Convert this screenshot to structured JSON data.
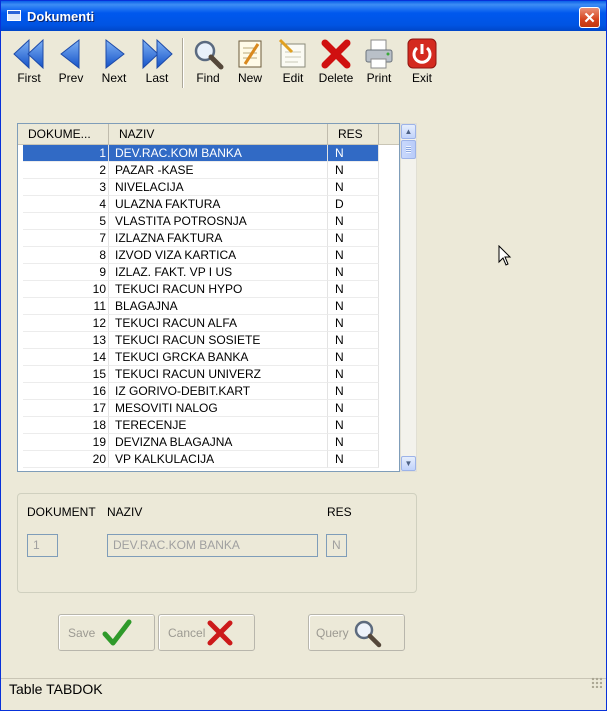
{
  "window": {
    "title": "Dokumenti",
    "close_glyph": "✕"
  },
  "toolbar": {
    "buttons": [
      {
        "id": "first",
        "label": "First",
        "icon": "double-left-arrow-icon"
      },
      {
        "id": "prev",
        "label": "Prev",
        "icon": "left-arrow-icon"
      },
      {
        "id": "next",
        "label": "Next",
        "icon": "right-arrow-icon"
      },
      {
        "id": "last",
        "label": "Last",
        "icon": "double-right-arrow-icon"
      },
      {
        "id": "find",
        "label": "Find",
        "icon": "magnifier-icon"
      },
      {
        "id": "new",
        "label": "New",
        "icon": "notepad-icon"
      },
      {
        "id": "edit",
        "label": "Edit",
        "icon": "edit-document-icon"
      },
      {
        "id": "delete",
        "label": "Delete",
        "icon": "red-x-icon"
      },
      {
        "id": "print",
        "label": "Print",
        "icon": "printer-icon"
      },
      {
        "id": "exit",
        "label": "Exit",
        "icon": "power-icon"
      }
    ]
  },
  "grid": {
    "columns": [
      "DOKUME...",
      "NAZIV",
      "RES"
    ],
    "selected_index": 0,
    "rows": [
      [
        "1",
        "DEV.RAC.KOM BANKA",
        "N"
      ],
      [
        "2",
        "PAZAR -KASE",
        "N"
      ],
      [
        "3",
        "NIVELACIJA",
        "N"
      ],
      [
        "4",
        "ULAZNA FAKTURA",
        "D"
      ],
      [
        "5",
        "VLASTITA POTROSNJA",
        "N"
      ],
      [
        "7",
        "IZLAZNA FAKTURA",
        "N"
      ],
      [
        "8",
        "IZVOD VIZA KARTICA",
        "N"
      ],
      [
        "9",
        "IZLAZ. FAKT. VP I US",
        "N"
      ],
      [
        "10",
        "TEKUCI RACUN HYPO",
        "N"
      ],
      [
        "11",
        "BLAGAJNA",
        "N"
      ],
      [
        "12",
        "TEKUCI RACUN ALFA",
        "N"
      ],
      [
        "13",
        "TEKUCI RACUN SOSIETE",
        "N"
      ],
      [
        "14",
        "TEKUCI GRCKA BANKA",
        "N"
      ],
      [
        "15",
        "TEKUCI RACUN UNIVERZ",
        "N"
      ],
      [
        "16",
        "IZ GORIVO-DEBIT.KART",
        "N"
      ],
      [
        "17",
        "MESOVITI NALOG",
        "N"
      ],
      [
        "18",
        "TERECENJE",
        "N"
      ],
      [
        "19",
        "DEVIZNA BLAGAJNA",
        "N"
      ],
      [
        "20",
        "VP KALKULACIJA",
        "N"
      ]
    ]
  },
  "detail": {
    "labels": {
      "dokument": "DOKUMENT",
      "naziv": "NAZIV",
      "res": "RES"
    },
    "values": {
      "dokument": "1",
      "naziv": "DEV.RAC.KOM BANKA",
      "res": "N"
    }
  },
  "actions": {
    "save": "Save",
    "cancel": "Cancel",
    "query": "Query"
  },
  "status": {
    "text": "Table TABDOK"
  },
  "colors": {
    "title_bar": "#0054E3",
    "selection": "#316AC5",
    "face": "#ECE9D8"
  }
}
